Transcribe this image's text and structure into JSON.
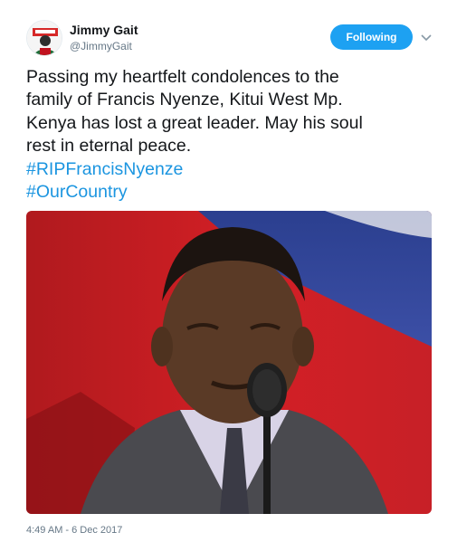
{
  "user": {
    "display_name": "Jimmy Gait",
    "handle": "@JimmyGait"
  },
  "follow_button": {
    "label": "Following"
  },
  "tweet": {
    "text_lines": [
      "Passing my heartfelt condolences to the",
      "family of Francis Nyenze, Kitui West Mp.",
      "Kenya has lost a great leader. May his soul",
      "rest in eternal peace."
    ],
    "hashtags": [
      "#RIPFrancisNyenze",
      "#OurCountry"
    ],
    "timestamp": "4:49 AM - 6 Dec 2017"
  },
  "icons": {
    "menu_caret": "chevron-down-icon"
  },
  "colors": {
    "accent": "#1da1f2",
    "hashtag": "#1b95e0",
    "text": "#14171a",
    "muted": "#657786"
  }
}
